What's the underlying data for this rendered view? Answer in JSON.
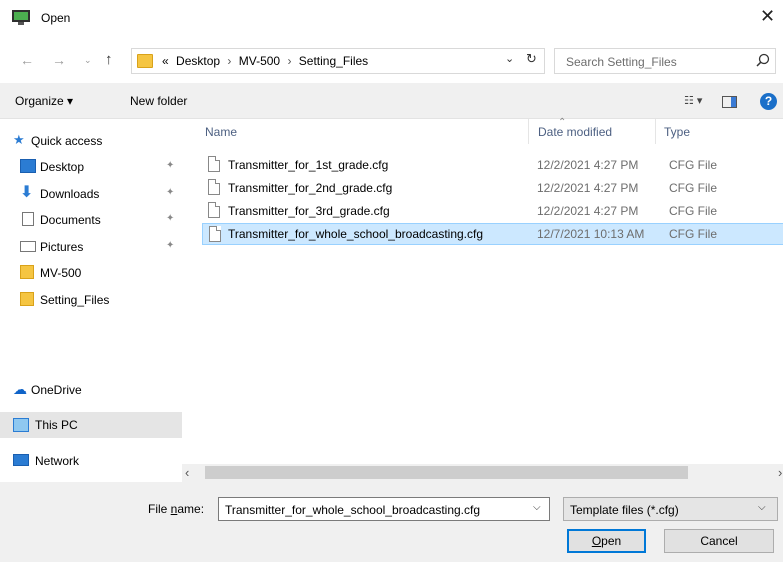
{
  "window": {
    "title": "Open"
  },
  "address": {
    "crumbs": [
      "«",
      "Desktop",
      "›",
      "MV-500",
      "›",
      "Setting_Files"
    ],
    "search_placeholder": "Search Setting_Files"
  },
  "toolbar": {
    "organize_label": "Organize ▾",
    "new_folder_label": "New folder",
    "view_glyph": "☷ ▾"
  },
  "nav": [
    {
      "label": "Quick access",
      "icon": "star-icon",
      "pinned": false
    },
    {
      "label": "Desktop",
      "icon": "desktop-icon",
      "pinned": true
    },
    {
      "label": "Downloads",
      "icon": "downloads-icon",
      "pinned": true
    },
    {
      "label": "Documents",
      "icon": "documents-icon",
      "pinned": true
    },
    {
      "label": "Pictures",
      "icon": "pictures-icon",
      "pinned": true
    },
    {
      "label": "MV-500",
      "icon": "folder-icon",
      "pinned": false
    },
    {
      "label": "Setting_Files",
      "icon": "folder-icon",
      "pinned": false
    },
    {
      "label": "OneDrive",
      "icon": "onedrive-icon",
      "pinned": false
    },
    {
      "label": "This PC",
      "icon": "this-pc-icon",
      "pinned": false,
      "selected": true
    },
    {
      "label": "Network",
      "icon": "network-icon",
      "pinned": false
    }
  ],
  "columns": {
    "name": "Name",
    "date": "Date modified",
    "type": "Type"
  },
  "files": [
    {
      "name": "Transmitter_for_1st_grade.cfg",
      "date": "12/2/2021 4:27 PM",
      "type": "CFG File",
      "selected": false
    },
    {
      "name": "Transmitter_for_2nd_grade.cfg",
      "date": "12/2/2021 4:27 PM",
      "type": "CFG File",
      "selected": false
    },
    {
      "name": "Transmitter_for_3rd_grade.cfg",
      "date": "12/2/2021 4:27 PM",
      "type": "CFG File",
      "selected": false
    },
    {
      "name": "Transmitter_for_whole_school_broadcasting.cfg",
      "date": "12/7/2021 10:13 AM",
      "type": "CFG File",
      "selected": true
    }
  ],
  "footer": {
    "file_name_prefix": "File ",
    "file_name_underlined": "n",
    "file_name_suffix": "ame:",
    "file_name_value": "Transmitter_for_whole_school_broadcasting.cfg",
    "file_type_value": "Template files (*.cfg)",
    "open_underlined": "O",
    "open_rest": "pen",
    "cancel_label": "Cancel"
  },
  "colors": {
    "accent": "#0078d7",
    "selection": "#cce8ff",
    "folder": "#f5c542"
  }
}
